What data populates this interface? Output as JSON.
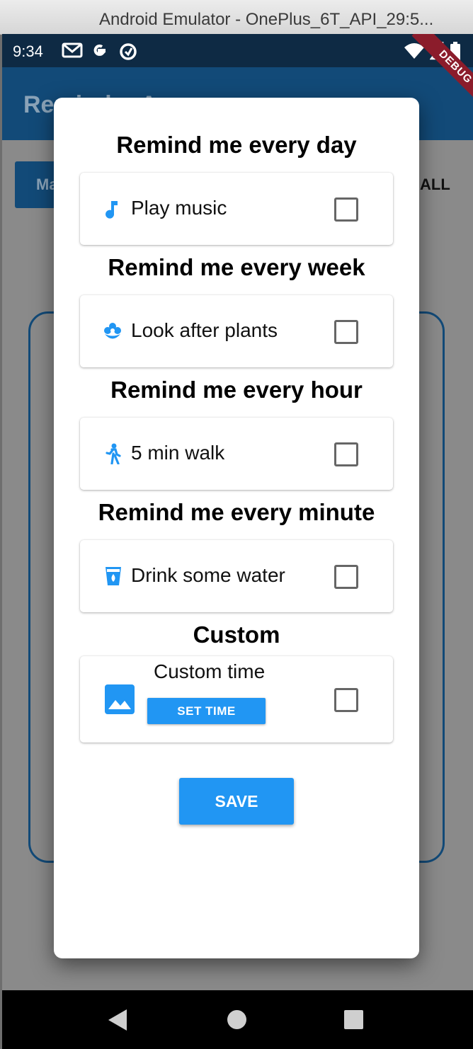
{
  "window": {
    "title": "Android Emulator - OnePlus_6T_API_29:5..."
  },
  "statusbar": {
    "time": "9:34"
  },
  "background": {
    "appbar_title": "Reminder App",
    "left_button": "Ma",
    "right_text": "ALL",
    "debug_banner": "DEBUG"
  },
  "dialog": {
    "sections": [
      {
        "title": "Remind me every day",
        "item": "Play music",
        "icon": "music-note-icon",
        "checked": false
      },
      {
        "title": "Remind me every week",
        "item": "Look after plants",
        "icon": "flower-icon",
        "checked": false
      },
      {
        "title": "Remind me every hour",
        "item": "5 min walk",
        "icon": "walk-icon",
        "checked": false
      },
      {
        "title": "Remind me every minute",
        "item": "Drink some water",
        "icon": "water-cup-icon",
        "checked": false
      }
    ],
    "custom": {
      "title": "Custom",
      "label": "Custom time",
      "button": "SET TIME",
      "icon": "image-icon",
      "checked": false
    },
    "save": "SAVE"
  },
  "colors": {
    "accent": "#2196f3",
    "appbar": "#124a78",
    "statusbar": "#0e2a44"
  }
}
